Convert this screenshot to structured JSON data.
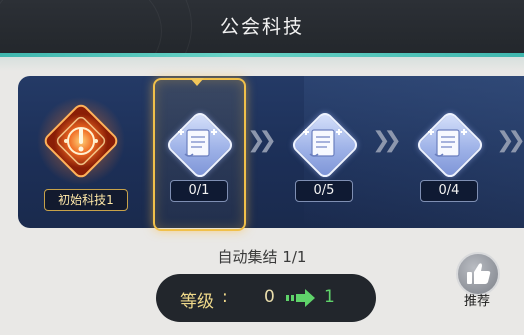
{
  "header": {
    "title": "公会科技"
  },
  "initial_tech": {
    "label": "初始科技1"
  },
  "tech_nodes": [
    {
      "count": "0/1",
      "selected": true
    },
    {
      "count": "0/5",
      "selected": false
    },
    {
      "count": "0/4",
      "selected": false
    }
  ],
  "auto_assemble": {
    "label": "自动集结",
    "value": "1/1"
  },
  "level": {
    "label": "等级",
    "colon": ":",
    "current": "0",
    "next": "1"
  },
  "recommend": {
    "label": "推荐",
    "icon": "thumbs-up-icon"
  },
  "colors": {
    "accent_teal": "#4fc1b6",
    "selected_gold": "#f1c04a",
    "next_level_green": "#5fd36a"
  }
}
